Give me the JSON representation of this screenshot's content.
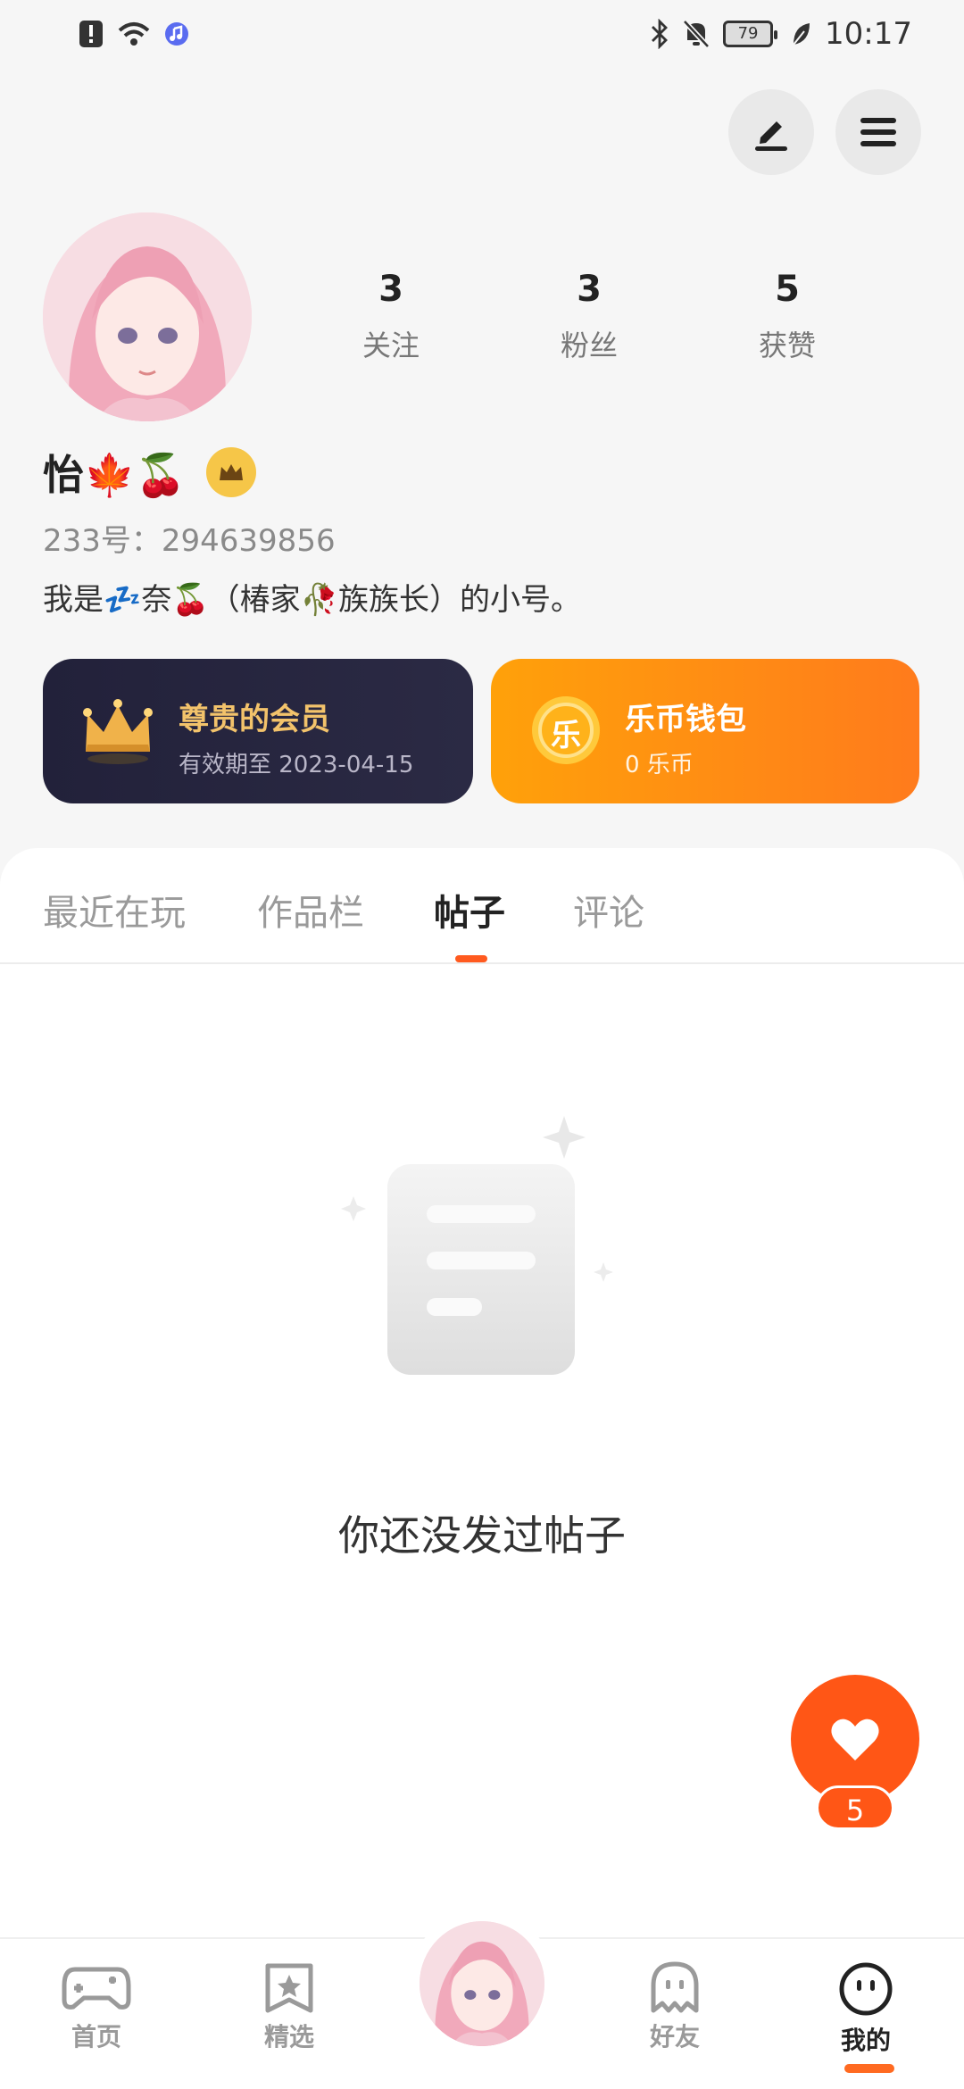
{
  "status_bar": {
    "time": "10:17",
    "battery": "79",
    "left_icons": [
      "alert-icon",
      "wifi-icon",
      "music-app-icon"
    ],
    "right_icons": [
      "bluetooth-icon",
      "mute-icon",
      "battery-icon",
      "leaf-icon"
    ]
  },
  "header": {
    "edit_icon": "edit-icon",
    "menu_icon": "menu-icon"
  },
  "profile": {
    "name": "怡🍁🍒",
    "id_line": "233号：294639856",
    "bio": "我是💤奈🍒（椿家🥀族族长）的小号。",
    "stats": [
      {
        "value": "3",
        "label": "关注"
      },
      {
        "value": "3",
        "label": "粉丝"
      },
      {
        "value": "5",
        "label": "获赞"
      }
    ]
  },
  "cards": {
    "vip": {
      "title": "尊贵的会员",
      "subtitle": "有效期至 2023-04-15",
      "icon": "crown-icon"
    },
    "wallet": {
      "title": "乐币钱包",
      "subtitle": "0 乐币",
      "coin_glyph": "乐"
    }
  },
  "tabs": [
    {
      "label": "最近在玩",
      "active": false
    },
    {
      "label": "作品栏",
      "active": false
    },
    {
      "label": "帖子",
      "active": true
    },
    {
      "label": "评论",
      "active": false
    }
  ],
  "empty_state": {
    "text": "你还没发过帖子"
  },
  "like_fab": {
    "count": "5"
  },
  "bottom_nav": [
    {
      "label": "首页",
      "icon": "gamepad-icon",
      "active": false
    },
    {
      "label": "精选",
      "icon": "star-bookmark-icon",
      "active": false
    },
    {
      "label": "",
      "icon": "avatar",
      "active": false
    },
    {
      "label": "好友",
      "icon": "ghost-icon",
      "active": false
    },
    {
      "label": "我的",
      "icon": "face-icon",
      "active": true
    }
  ],
  "colors": {
    "accent": "#ff5616",
    "vip_bg": "#22213a",
    "vip_gold": "#f3c36b",
    "wallet_orange": "#ff8f14",
    "avatar_pink": "#f4b7c6"
  }
}
